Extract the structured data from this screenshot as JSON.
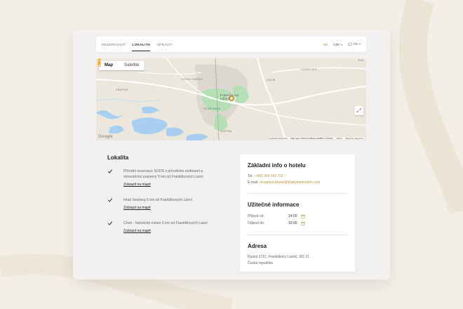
{
  "nav": {
    "tabs": [
      {
        "label": "REZERVOVAT",
        "active": false
      },
      {
        "label": "LOKALITA",
        "active": true
      },
      {
        "label": "UPRAVIT",
        "active": false
      }
    ],
    "currency_code": "Kč",
    "currency": "CZK",
    "language": "CS"
  },
  "map": {
    "type_map": "Map",
    "type_satellite": "Satellite",
    "labels": {
      "dolni_lomany": "DOLNÍ LOMANY",
      "city": "Františkovy Lázně",
      "horni_ves": "HORNÍ VES",
      "aleje": "ALEJE",
      "krapice": "KRAPICE",
      "tower": "TOLER AREA",
      "slatina": "SLATINA",
      "treb": "Treb"
    },
    "attribution": {
      "shortcuts": "Keyboard shortcuts",
      "data": "Map data ©2025 GeoBasis-DE/BKG (©2009)",
      "terms": "Terms",
      "report": "Report a map error"
    },
    "google": "Google"
  },
  "lokalita": {
    "title": "Lokalita",
    "items": [
      {
        "text": "Přírodní rezervace SOOS s přírodními mofetami a minerálními prameny 5 km od Františkových Lázní",
        "link": "Zobrazit na mapě"
      },
      {
        "text": "Hrad Seeberg 5 km od Františkových Lázní",
        "link": "Zobrazit na mapě"
      },
      {
        "text": "Cheb - historické město 5 km od Františkových Lázní",
        "link": "Zobrazit na mapě"
      }
    ]
  },
  "info": {
    "title": "Základní info o hotelu",
    "tel_label": "Tel.:",
    "tel": "+420 354 542 701",
    "email_label": "E-mail:",
    "email": "reception.bhotel@bladymenhotels.com",
    "useful_title": "Užitečné informace",
    "checkin_label": "Příjezd od:",
    "checkin": "14:00",
    "checkout_label": "Odjezd do:",
    "checkout": "10:00",
    "address_title": "Adresa",
    "address_line1": "Ruská 2712, Františkovy Lázně, 351 01",
    "address_line2": "Česká republika"
  },
  "colors": {
    "accent": "#b8963f",
    "park": "#b5e0b5"
  }
}
